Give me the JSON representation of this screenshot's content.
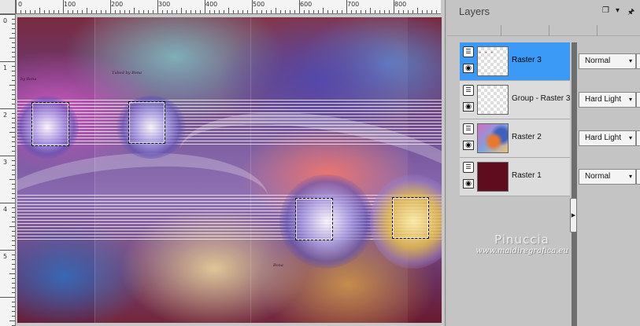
{
  "rulers": {
    "top_labels": [
      "0",
      "100",
      "200",
      "300",
      "400",
      "500",
      "600",
      "700",
      "800"
    ],
    "left_labels": [
      "0",
      "1",
      "2",
      "3",
      "4",
      "5"
    ]
  },
  "canvas": {
    "signatures": [
      "by Bona",
      "Tubed by Bona",
      "Bona"
    ]
  },
  "layers_panel": {
    "title": "Layers",
    "layers": [
      {
        "name": "Raster 3",
        "blend_mode": "Normal",
        "selected": true
      },
      {
        "name": "Group - Raster 3",
        "blend_mode": "Hard Light",
        "selected": false
      },
      {
        "name": "Raster 2",
        "blend_mode": "Hard Light",
        "selected": false
      },
      {
        "name": "Raster 1",
        "blend_mode": "Normal",
        "selected": false
      }
    ],
    "raster1_color": "#5e0c1e",
    "selected_color": "#3a9af5"
  },
  "watermark": {
    "name": "Pinuccia",
    "url": "www.maidiregrafica.eu"
  }
}
